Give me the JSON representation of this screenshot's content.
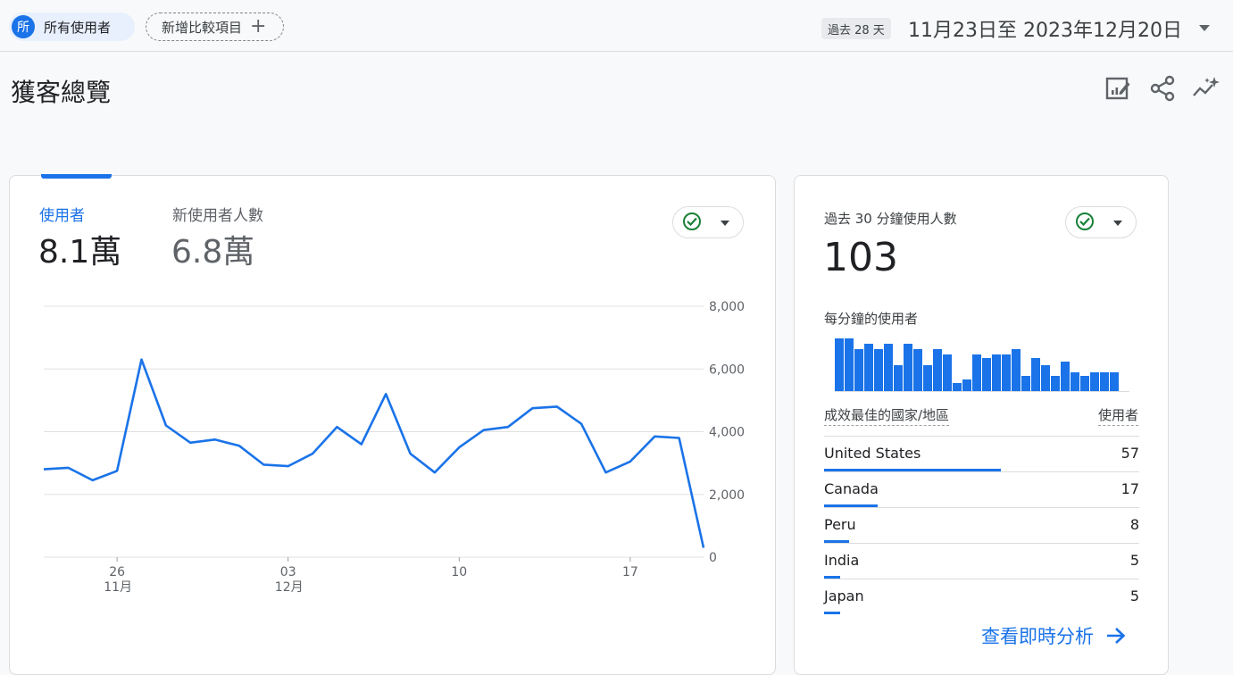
{
  "segment": {
    "avatar_letter": "所",
    "label": "所有使用者"
  },
  "compare": {
    "label": "新增比較項目",
    "plus": "+"
  },
  "date_range": {
    "badge": "過去 28 天",
    "text": "11月23日至 2023年12月20日"
  },
  "page": {
    "title": "獲客總覽"
  },
  "header_icons": [
    "edit-report-icon",
    "share-icon",
    "insights-icon"
  ],
  "colors": {
    "accent": "#1a73e8",
    "check": "#188038"
  },
  "overview_card": {
    "metrics": [
      {
        "label": "使用者",
        "value": "8.1萬"
      },
      {
        "label": "新使用者人數",
        "value": "6.8萬"
      }
    ]
  },
  "chart_data": {
    "type": "line",
    "series": [
      {
        "values": [
          2800,
          2850,
          2450,
          2750,
          6300,
          4200,
          3650,
          3750,
          3550,
          2950,
          2900,
          3300,
          4150,
          3600,
          5200,
          3300,
          2700,
          3500,
          4050,
          4150,
          4750,
          4800,
          4250,
          2700,
          3050,
          3850,
          3800,
          300
        ]
      }
    ],
    "x": [
      "11-23",
      "11-24",
      "11-25",
      "11-26",
      "11-27",
      "11-28",
      "11-29",
      "11-30",
      "12-01",
      "12-02",
      "12-03",
      "12-04",
      "12-05",
      "12-06",
      "12-07",
      "12-08",
      "12-09",
      "12-10",
      "12-11",
      "12-12",
      "12-13",
      "12-14",
      "12-15",
      "12-16",
      "12-17",
      "12-18",
      "12-19",
      "12-20"
    ],
    "xticks": [
      {
        "day": "26",
        "month": "11月"
      },
      {
        "day": "03",
        "month": "12月"
      },
      {
        "day": "10",
        "month": ""
      },
      {
        "day": "17",
        "month": ""
      }
    ],
    "yticks": [
      "8,000",
      "6,000",
      "4,000",
      "2,000",
      "0"
    ],
    "ylim": [
      0,
      8000
    ],
    "grid": true
  },
  "realtime_card": {
    "label": "過去 30 分鐘使用人數",
    "value": "103",
    "per_minute_label": "每分鐘的使用者",
    "per_minute_values": [
      5,
      5,
      4,
      4.5,
      4,
      4.5,
      2.5,
      4.5,
      4,
      2.5,
      4,
      3.5,
      0.8,
      1.2,
      3.5,
      3.2,
      3.5,
      3.5,
      4,
      1.5,
      3.2,
      2.5,
      1.5,
      2.8,
      1.8,
      1.5,
      1.8,
      1.8,
      1.8,
      0
    ],
    "table_header": {
      "dimension": "成效最佳的國家/地區",
      "metric": "使用者"
    },
    "rows": [
      {
        "name": "United States",
        "value": "57",
        "share": 0.56
      },
      {
        "name": "Canada",
        "value": "17",
        "share": 0.17
      },
      {
        "name": "Peru",
        "value": "8",
        "share": 0.08
      },
      {
        "name": "India",
        "value": "5",
        "share": 0.05
      },
      {
        "name": "Japan",
        "value": "5",
        "share": 0.05
      }
    ],
    "link_label": "查看即時分析"
  }
}
